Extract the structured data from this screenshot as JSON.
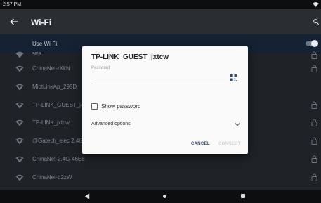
{
  "status_bar": {
    "time": "2:57 PM",
    "wifi_icon": "wifi-icon"
  },
  "app_bar": {
    "title": "Wi-Fi",
    "back_icon": "arrow-back-icon",
    "search_icon": "search-icon"
  },
  "use_wifi": {
    "label": "Use Wi-Fi",
    "enabled": true
  },
  "networks": [
    {
      "name": "9F9",
      "locked": true
    },
    {
      "name": "ChinaNet-rXkN",
      "locked": true
    },
    {
      "name": "MiotLinkAp_295D",
      "locked": false
    },
    {
      "name": "TP-LINK_GUEST_jxtcw",
      "locked": true
    },
    {
      "name": "TP-LINK_jxtcw",
      "locked": true
    },
    {
      "name": "@Gatech_elec 2.4G",
      "locked": true
    },
    {
      "name": "ChinaNet-2.4G-46E8",
      "locked": true
    },
    {
      "name": "ChinaNet-b2zW",
      "locked": true
    }
  ],
  "dialog": {
    "title": "TP-LINK_GUEST_jxtcw",
    "password_label": "Password",
    "password_value": "",
    "show_password_label": "Show password",
    "show_password_checked": false,
    "advanced_options_label": "Advanced options",
    "cancel_label": "CANCEL",
    "connect_label": "CONNECT",
    "connect_enabled": false
  },
  "nav_bar": {
    "back": "nav-back-icon",
    "home": "nav-home-icon",
    "recents": "nav-recents-icon"
  }
}
